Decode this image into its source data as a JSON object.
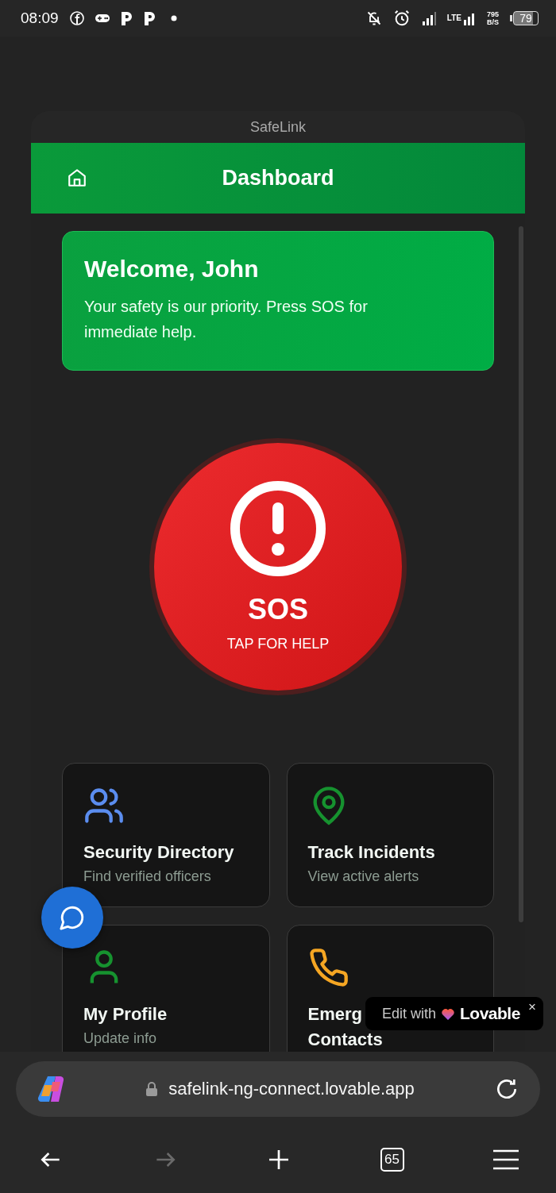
{
  "status_bar": {
    "time": "08:09",
    "network": "LTE",
    "speed": "795",
    "speed_unit": "B/S",
    "battery": "79"
  },
  "app": {
    "title": "SafeLink",
    "header": {
      "title": "Dashboard"
    },
    "welcome": {
      "title": "Welcome, John",
      "text": "Your safety is our priority. Press SOS for immediate help."
    },
    "sos": {
      "label": "SOS",
      "hint": "TAP FOR HELP"
    },
    "cards": [
      {
        "kind": "users",
        "color": "#5b8def",
        "title": [
          "Security Directory"
        ],
        "subtitle": "Find verified officers"
      },
      {
        "kind": "pin",
        "color": "#16922f",
        "title": [
          "Track Incidents"
        ],
        "subtitle": "View active alerts"
      },
      {
        "kind": "user",
        "color": "#16922f",
        "title": [
          "My Profile"
        ],
        "subtitle": "Update info"
      },
      {
        "kind": "phone",
        "color": "#f5a623",
        "title": [
          "Emerg",
          "Contacts"
        ]
      }
    ]
  },
  "badge": {
    "text": "Edit with",
    "brand": "Lovable",
    "close": "×"
  },
  "browser": {
    "url": "safelink-ng-connect.lovable.app",
    "tab_count": "65",
    "forward_disabled": true
  }
}
